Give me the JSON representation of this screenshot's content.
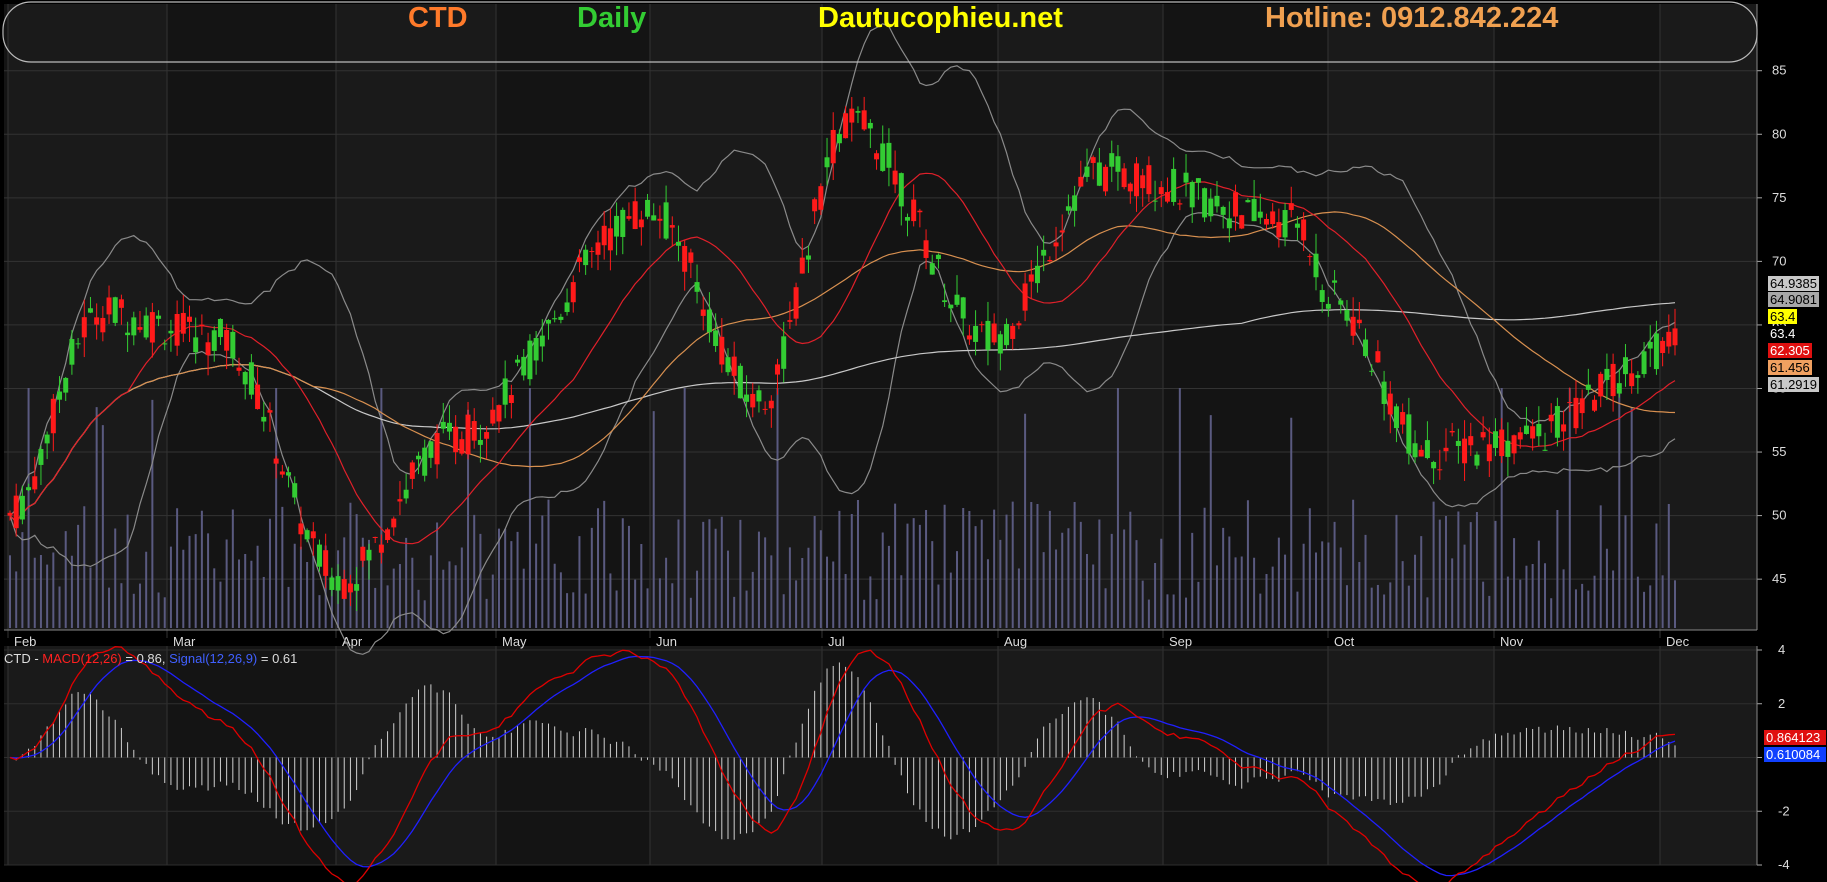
{
  "header": {
    "ticker": "CTD",
    "period": "Daily",
    "site": "Dautucophieu.net",
    "hotline": "Hotline: 0912.842.224"
  },
  "colors": {
    "background": "#000000",
    "panel": "#141414",
    "candle_up": "#33cc33",
    "candle_down": "#ff1a1a",
    "ma_red": "#e0202a",
    "ma_orange": "#d89050",
    "ma_white": "#c8c8c8",
    "bollinger": "#8a8a8a",
    "volume": "#5a5a80",
    "macd_line": "#e00000",
    "signal_line": "#2020ff"
  },
  "price_axis": {
    "ticks": [
      "85",
      "80",
      "75",
      "70",
      "65",
      "60",
      "55",
      "50",
      "45"
    ]
  },
  "months": [
    "Feb",
    "Mar",
    "Apr",
    "May",
    "Jun",
    "Jul",
    "Aug",
    "Sep",
    "Oct",
    "Nov",
    "Dec"
  ],
  "price_labels": [
    {
      "text": "64.9385",
      "bg": "#c8c8c8",
      "fg": "#000000"
    },
    {
      "text": "64.9081",
      "bg": "#a8a8a8",
      "fg": "#000000"
    },
    {
      "text": "63.4",
      "bg": "#ffff00",
      "fg": "#000000"
    },
    {
      "text": "63.4",
      "bg": "#000000",
      "fg": "#ffffff"
    },
    {
      "text": "62.305",
      "bg": "#e01010",
      "fg": "#ffffff"
    },
    {
      "text": "61.456",
      "bg": "#f0a060",
      "fg": "#000000"
    },
    {
      "text": "61.2919",
      "bg": "#c8c8c8",
      "fg": "#000000"
    }
  ],
  "macd": {
    "ticker": "CTD",
    "sep": " - ",
    "macd_label": "MACD(12,26)",
    "macd_value_text": " = 0.86, ",
    "signal_label": "Signal(12,26,9)",
    "signal_value_text": " = 0.61",
    "ticks": [
      "4",
      "2",
      "0",
      "-2",
      "-4"
    ],
    "right_labels": [
      {
        "text": "0.864123",
        "bg": "#e01010",
        "fg": "#ffffff"
      },
      {
        "text": "0.610084",
        "bg": "#1040ff",
        "fg": "#ffffff"
      }
    ],
    "last_macd": 0.86,
    "last_signal": 0.61
  },
  "chart_data": [
    {
      "type": "candlestick",
      "title": "CTD Daily",
      "ylim": [
        41,
        86
      ],
      "x_categories": [
        "Feb",
        "Mar",
        "Apr",
        "May",
        "Jun",
        "Jul",
        "Aug",
        "Sep",
        "Oct",
        "Nov",
        "Dec"
      ],
      "last_close": 63.4,
      "indicators": {
        "bollinger_upper": 64.9385,
        "ma_white": 64.9081,
        "ma_red": 62.305,
        "ma_orange": 61.456,
        "bollinger_lower": 61.2919
      },
      "close_anchors": [
        {
          "x": "Feb",
          "close": 50
        },
        {
          "x": "Feb",
          "close": 66
        },
        {
          "x": "Mar",
          "close": 64
        },
        {
          "x": "Apr",
          "close": 45
        },
        {
          "x": "May",
          "close": 56
        },
        {
          "x": "Jun",
          "close": 74
        },
        {
          "x": "Jun",
          "close": 59
        },
        {
          "x": "Jul",
          "close": 81
        },
        {
          "x": "Aug",
          "close": 64
        },
        {
          "x": "Aug",
          "close": 77
        },
        {
          "x": "Sep",
          "close": 73
        },
        {
          "x": "Oct",
          "close": 67
        },
        {
          "x": "Oct",
          "close": 55
        },
        {
          "x": "Nov",
          "close": 56
        },
        {
          "x": "Dec",
          "close": 63.4
        }
      ]
    },
    {
      "type": "line",
      "title": "MACD(12,26) / Signal(12,26,9)",
      "ylim": [
        -4,
        4
      ],
      "series": [
        {
          "name": "MACD(12,26)",
          "last": 0.86
        },
        {
          "name": "Signal(12,26,9)",
          "last": 0.61
        }
      ]
    }
  ]
}
